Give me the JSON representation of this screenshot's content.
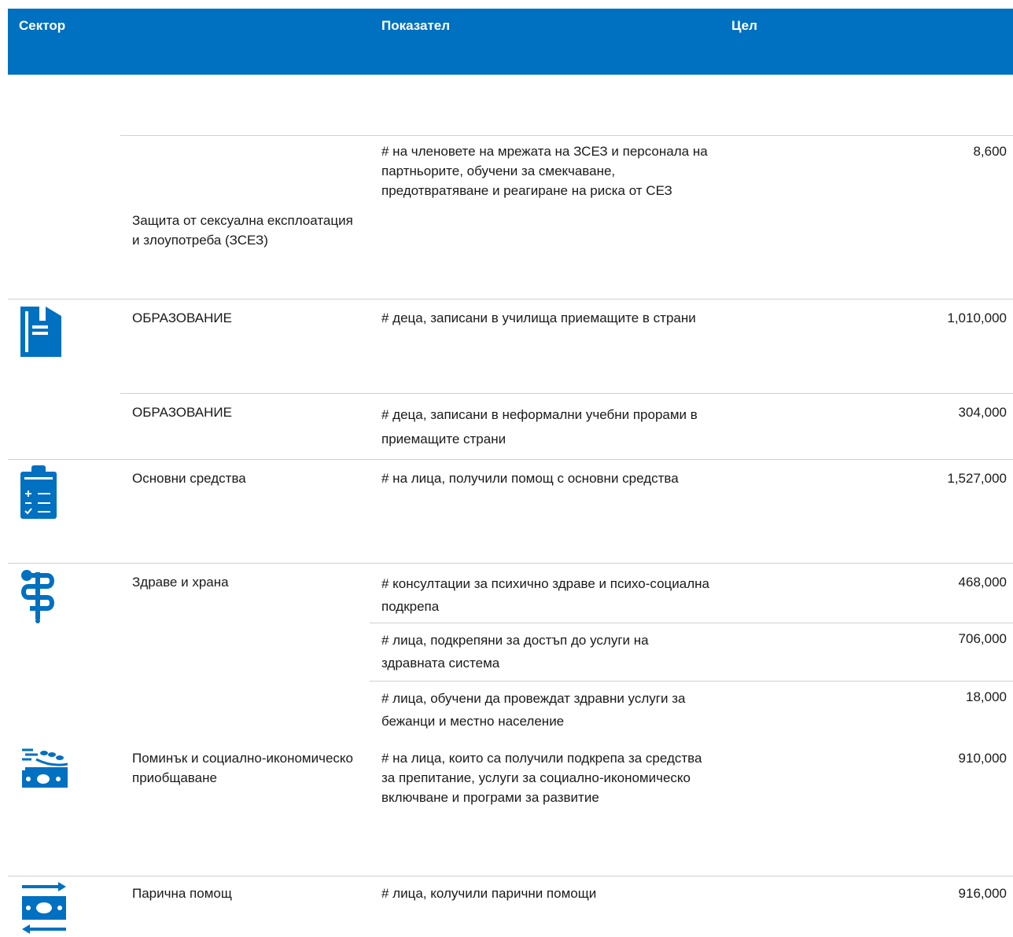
{
  "header": {
    "sector": "Сектор",
    "indicator": "Показател",
    "target": "Цел"
  },
  "rows": [
    {
      "sector": "Защита от сексуална експлоатация и злоупотреба (ЗСЕЗ)",
      "indicators": [
        {
          "text": "# на членовете на мрежата на ЗСЕЗ и персонала на партньорите, обучени за смекчаване, предотвратяване и реагиране на риска от СЕЗ",
          "target": "8,600"
        }
      ]
    },
    {
      "sector": "ОБРАЗОВАНИЕ",
      "icon": "education-book-icon",
      "indicators": [
        {
          "text": "# деца, записани в училища приемащите в страни",
          "target": "1,010,000"
        }
      ]
    },
    {
      "sector": "ОБРАЗОВАНИЕ",
      "indicators": [
        {
          "text": "# деца, записани в неформални учебни прорами в приемащите страни",
          "target": "304,000"
        }
      ]
    },
    {
      "sector": "Основни средства",
      "icon": "clipboard-checklist-icon",
      "indicators": [
        {
          "text": "# на лица, получили помощ с основни средства",
          "target": "1,527,000"
        }
      ]
    },
    {
      "sector": "Здраве и храна",
      "icon": "health-caduceus-icon",
      "indicators": [
        {
          "text": "#  консултации за психично здраве и психо-социална подкрепа",
          "target": "468,000"
        },
        {
          "text": "# лица, подкрепяни за достъп до услуги на здравната система",
          "target": "706,000"
        },
        {
          "text": "# лица, обучени да провеждат здравни услуги за бежанци и местно население",
          "target": "18,000"
        }
      ]
    },
    {
      "sector": "Поминък и социално-икономическо приобщаване",
      "icon": "livelihood-grain-money-icon",
      "indicators": [
        {
          "text": "# на лица, които са получили подкрепа за средства за препитание, услуги за социално-икономическо включване и програми за развитие",
          "target": "910,000"
        }
      ]
    },
    {
      "sector": "Парична помощ",
      "icon": "cash-transfer-icon",
      "indicators": [
        {
          "text": "# лица, колучили парични помощи",
          "target": "916,000"
        }
      ]
    }
  ],
  "colors": {
    "header_bg": "#0070c0",
    "icon": "#0070c0",
    "rule": "#d0d0d0"
  }
}
